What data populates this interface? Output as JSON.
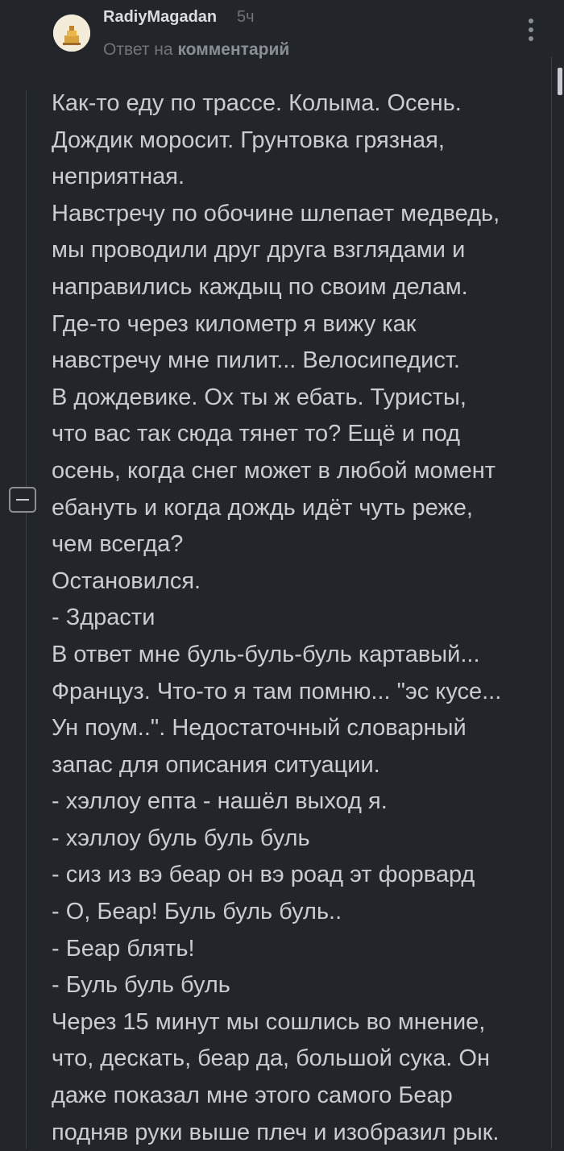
{
  "comment": {
    "author": "RadiyMagadan",
    "time": "5ч",
    "reply_prefix": "Ответ на",
    "reply_target": "комментарий",
    "lines": [
      "Как-то еду по трассе. Колыма. Осень.",
      "Дождик моросит. Грунтовка грязная,",
      "неприятная.",
      "Навстречу по обочине шлепает медведь,",
      "мы проводили друг друга взглядами и",
      "направились каждыц по своим делам.",
      "Где-то через километр я вижу как",
      "навстречу мне пилит... Велосипедист.",
      "В дождевике. Ох ты ж ебать. Туристы,",
      "что вас так сюда тянет то? Ещё и под",
      "осень, когда снег может в любой момент",
      "ебануть и когда дождь идёт чуть реже,",
      "чем всегда?",
      "Остановился.",
      "- Здрасти",
      "В ответ мне буль-буль-буль картавый...",
      "Француз. Что-то я там помню... \"эс кусе...",
      "Ун поум..\". Недостаточный словарный",
      "запас для описания ситуации.",
      "- хэллоу епта - нашёл выход я.",
      "- хэллоу буль буль буль",
      "- сиз из вэ беар он вэ роад эт форвард",
      "- О, Беар! Буль буль буль..",
      "- Беар блять!",
      "- Буль буль буль",
      "Через 15 минут мы сошлись во мнение,",
      "что, дескать, беар да, большой сука. Он",
      "даже показал мне этого самого Беар",
      "подняв руки выше плеч и изобразил рык."
    ]
  },
  "icons": {
    "avatar": "avatar-image",
    "more": "more-vertical-icon",
    "collapse": "collapse-minus-icon"
  },
  "colors": {
    "background": "#22252a",
    "text": "#c9ccd1",
    "muted": "#6f747b"
  }
}
